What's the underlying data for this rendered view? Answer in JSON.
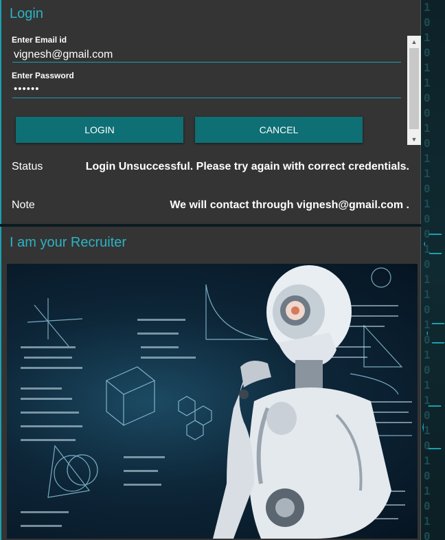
{
  "login": {
    "title": "Login",
    "email_label": "Enter Email id",
    "email_value": "vignesh@gmail.com",
    "password_label": "Enter Password",
    "password_value": "••••••",
    "login_button": "LOGIN",
    "cancel_button": "CANCEL",
    "status_label": "Status",
    "status_value": "Login Unsuccessful. Please try again with correct credentials.",
    "note_label": "Note",
    "note_value": "We will contact through vignesh@gmail.com ."
  },
  "recruiter": {
    "title": "I am your Recruiter"
  },
  "background": {
    "bits": "1\n0\n1\n0\n1\n1\n0\n0\n1\n0\n1\n1\n0\n1\n0\n0\n1\n0\n1\n1\n0\n1\n0\n1\n0\n1\n1\n0\n1\n0\n1\n0\n1\n0\n1\n0"
  },
  "colors": {
    "accent": "#2bb4c4",
    "button": "#0e6f75",
    "panel": "#343434"
  }
}
